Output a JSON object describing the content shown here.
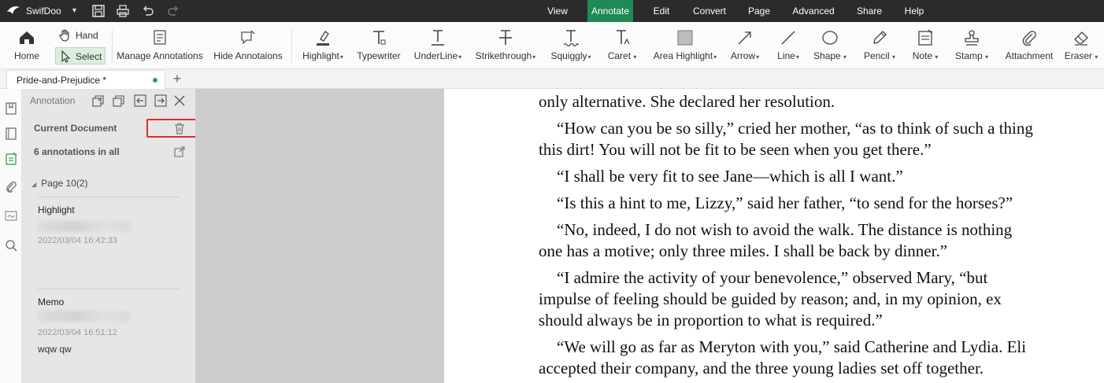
{
  "app": {
    "name": "SwifDoo"
  },
  "menu": [
    "View",
    "Annotate",
    "Edit",
    "Convert",
    "Page",
    "Advanced",
    "Share",
    "Help"
  ],
  "menu_active": "Annotate",
  "colors": {
    "accent": "#1f8a54",
    "highlight_box": "#e0302a",
    "titlebar": "#2b2b2b"
  },
  "toolbar": {
    "home": "Home",
    "hand": "Hand",
    "select": "Select",
    "manage": "Manage Annotations",
    "hide": "Hide Annotaions",
    "highlight": "Highlight",
    "typewriter": "Typewriter",
    "underline": "UnderLine",
    "strikethrough": "Strikethrough",
    "squiggly": "Squiggly",
    "caret": "Caret",
    "area_highlight": "Area Highlight",
    "arrow": "Arrow",
    "line": "Line",
    "shape": "Shape",
    "pencil": "Pencil",
    "note": "Note",
    "stamp": "Stamp",
    "attachment": "Attachment",
    "eraser": "Eraser"
  },
  "tab": {
    "title": "Pride-and-Prejudice *"
  },
  "panel": {
    "title": "Annotation",
    "current_document": "Current Document",
    "count": "6 annotations in all",
    "page_group": "Page 10(2)",
    "annotations": [
      {
        "type": "Highlight",
        "time": "2022/03/04 16:42:33",
        "note": ""
      },
      {
        "type": "Memo",
        "time": "2022/03/04 16:51:12",
        "note": "wqw qw"
      }
    ]
  },
  "document": {
    "lines": [
      "only alternative. She declared her resolution.",
      "“How can you be so silly,” cried her mother, “as to think of such a thing",
      "this dirt! You will not be fit to be seen when you get there.”",
      "“I shall be very fit to see Jane—which is all I want.”",
      "“Is this a hint to me, Lizzy,” said her father, “to send for the horses?”",
      "“No, indeed, I do not wish to avoid the walk. The distance is nothing",
      "one has a motive; only three miles. I shall be back by dinner.”",
      "“I admire the activity of your benevolence,” observed Mary, “but",
      "impulse of feeling should be guided by reason; and, in my opinion, ex",
      "should always be in proportion to what is required.”",
      "“We will go as far as Meryton with you,” said Catherine and Lydia. Eli",
      "accepted their company, and the three young ladies set off together."
    ]
  }
}
